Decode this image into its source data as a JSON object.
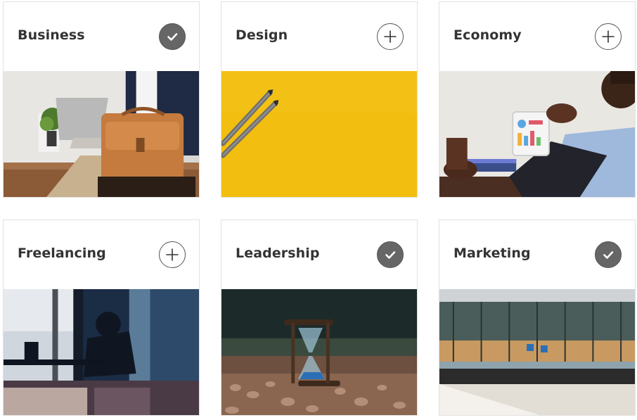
{
  "topics": [
    {
      "id": "business",
      "title": "Business",
      "selected": true,
      "image": "office-briefcase-photo"
    },
    {
      "id": "design",
      "title": "Design",
      "selected": false,
      "image": "pencils-on-yellow-photo"
    },
    {
      "id": "economy",
      "title": "Economy",
      "selected": false,
      "image": "tablet-chart-photo"
    },
    {
      "id": "freelancing",
      "title": "Freelancing",
      "selected": false,
      "image": "cafe-silhouette-photo"
    },
    {
      "id": "leadership",
      "title": "Leadership",
      "selected": true,
      "image": "hourglass-in-pebbles-photo"
    },
    {
      "id": "marketing",
      "title": "Marketing",
      "selected": true,
      "image": "glass-building-photo"
    }
  ],
  "colors": {
    "toggle_selected": "#666666",
    "toggle_border": "#555555",
    "title": "#333333",
    "card_border": "#e2e2e2"
  }
}
